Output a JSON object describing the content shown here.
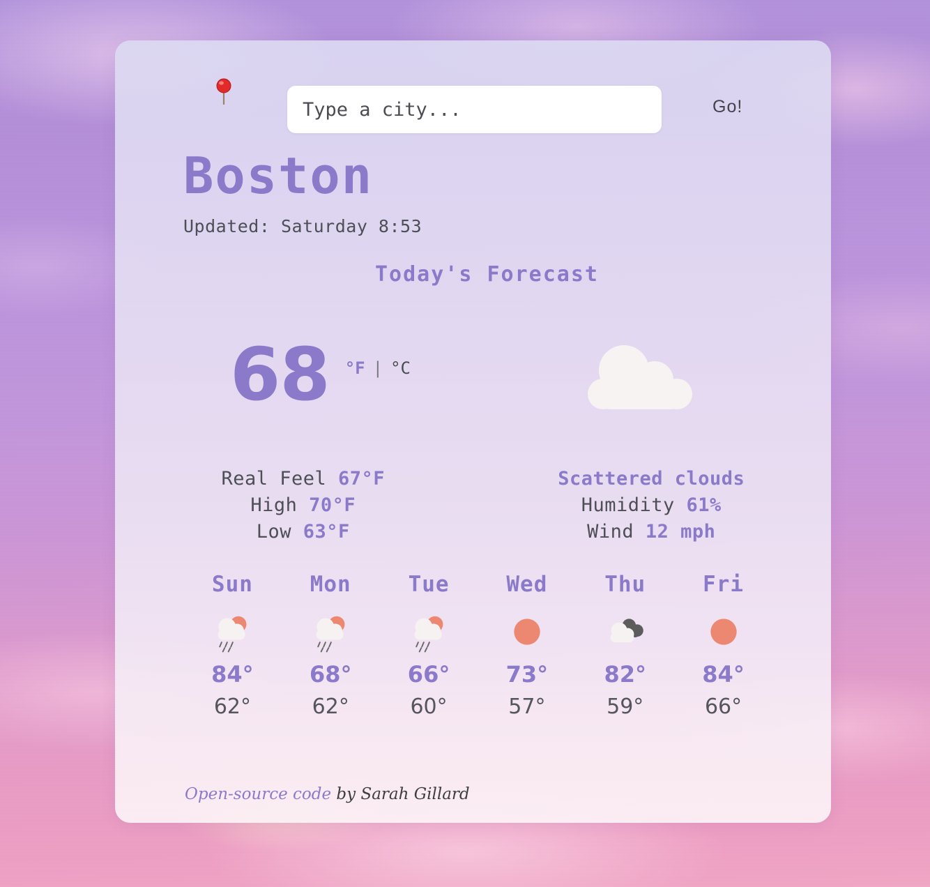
{
  "search": {
    "pin_icon": "round-pushpin",
    "placeholder": "Type a city...",
    "value": "",
    "go_label": "Go!"
  },
  "header": {
    "city": "Boston",
    "updated": "Updated: Saturday 8:53",
    "forecast_heading": "Today's Forecast"
  },
  "current": {
    "temperature": "68",
    "unit_fahrenheit": "°F",
    "unit_separator": "|",
    "unit_celsius": "°C",
    "active_unit": "fahrenheit",
    "icon": "cloud-icon"
  },
  "details": {
    "left": [
      {
        "label": "Real Feel",
        "value": "67°F"
      },
      {
        "label": "High",
        "value": "70°F"
      },
      {
        "label": "Low",
        "value": "63°F"
      }
    ],
    "description": "Scattered clouds",
    "right": [
      {
        "label": "Humidity",
        "value": "61%"
      },
      {
        "label": "Wind",
        "value": "12 mph"
      }
    ]
  },
  "forecast": [
    {
      "day": "Sun",
      "icon": "sun-behind-rain-cloud-icon",
      "high": "84°",
      "low": "62°"
    },
    {
      "day": "Mon",
      "icon": "sun-behind-rain-cloud-icon",
      "high": "68°",
      "low": "62°"
    },
    {
      "day": "Tue",
      "icon": "sun-behind-rain-cloud-icon",
      "high": "66°",
      "low": "60°"
    },
    {
      "day": "Wed",
      "icon": "sun-icon",
      "high": "73°",
      "low": "57°"
    },
    {
      "day": "Thu",
      "icon": "broken-clouds-icon",
      "high": "82°",
      "low": "59°"
    },
    {
      "day": "Fri",
      "icon": "sun-icon",
      "high": "84°",
      "low": "66°"
    }
  ],
  "footer": {
    "link_text": "Open-source code",
    "credit_text": " by Sarah Gillard"
  },
  "colors": {
    "accent_purple": "#8b7ac9",
    "body_text": "#4e4e56",
    "sun_orange": "#ec8871",
    "cloud_white": "#f6f2f2",
    "dark_cloud": "#5c5c5c",
    "card_top": "#dcdaf2",
    "card_bottom": "#fcf2f6"
  }
}
